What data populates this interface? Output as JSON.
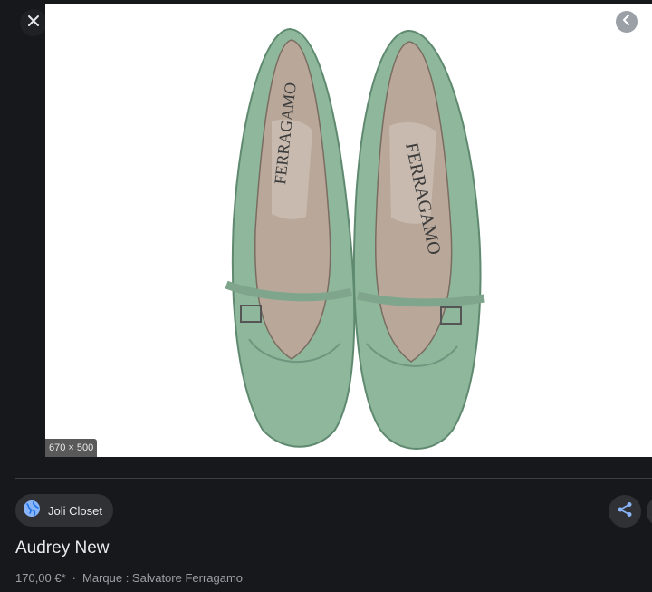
{
  "viewer": {
    "close_icon": "close-icon",
    "prev_icon": "chevron-left-icon",
    "image_dimensions": "670 × 500"
  },
  "source": {
    "name": "Joli Closet",
    "icon": "globe-icon"
  },
  "actions": {
    "share_icon": "share-icon"
  },
  "product": {
    "title": "Audrey New",
    "price": "170,00 €*",
    "separator": "·",
    "brand": "Marque : Salvatore Ferragamo"
  },
  "colors": {
    "background": "#17181c",
    "accent_blue": "#8ab4f8",
    "shoe_green": "#8fb79c"
  }
}
